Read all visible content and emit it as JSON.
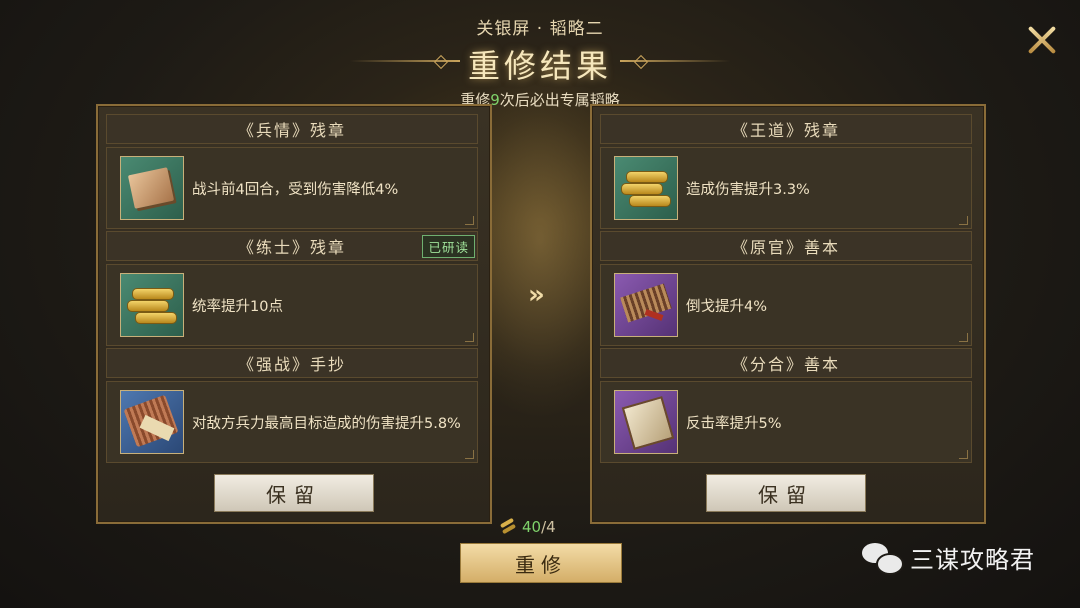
{
  "header": {
    "subtitle": "关银屏 · 韬略二",
    "title": "重修结果",
    "hint_prefix": "重修",
    "hint_num": "9",
    "hint_suffix": "次后必出专属韬略"
  },
  "left_panel": {
    "slots": [
      {
        "name": "《兵情》残章",
        "effect": "战斗前4回合，受到伤害降低4%",
        "icon": "book-icon",
        "icon_bg": "green",
        "badge": ""
      },
      {
        "name": "《练士》残章",
        "effect": "统率提升10点",
        "icon": "bamboo-scroll-icon",
        "icon_bg": "green",
        "badge": "已研读"
      },
      {
        "name": "《强战》手抄",
        "effect": "对敌方兵力最高目标造成的伤害提升5.8%",
        "icon": "rolled-scroll-icon",
        "icon_bg": "blue",
        "badge": ""
      }
    ],
    "keep_label": "保留"
  },
  "right_panel": {
    "slots": [
      {
        "name": "《王道》残章",
        "effect": "造成伤害提升3.3%",
        "icon": "bamboo-scroll-icon",
        "icon_bg": "green"
      },
      {
        "name": "《原官》善本",
        "effect": "倒戈提升4%",
        "icon": "bamboo-book-icon",
        "icon_bg": "purple"
      },
      {
        "name": "《分合》善本",
        "effect": "反击率提升5%",
        "icon": "open-book-icon",
        "icon_bg": "purple"
      }
    ],
    "keep_label": "保留"
  },
  "transfer_arrows": "»",
  "cost": {
    "have": "40",
    "sep": "/",
    "need": "4",
    "icon": "bamboo-slip-icon"
  },
  "reroll_label": "重修",
  "watermark": {
    "icon": "wechat-icon",
    "text": "三谋攻略君"
  },
  "colors": {
    "accent_green": "#7fd36b",
    "gold": "#c9a45c"
  }
}
